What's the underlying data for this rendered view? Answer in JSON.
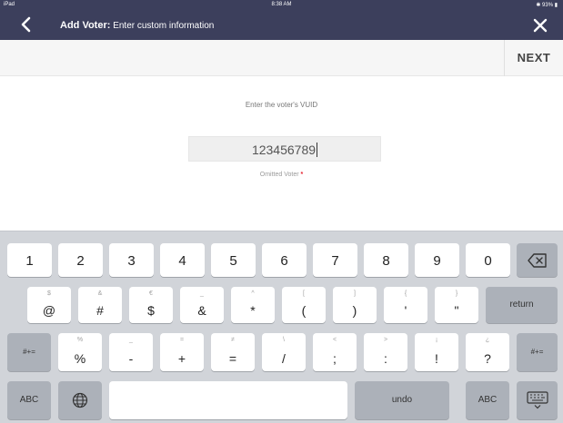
{
  "status_bar": {
    "left": "iPad",
    "time": "8:38 AM",
    "right": "✱ 93% ▮"
  },
  "header": {
    "back_icon": "chevron-left-icon",
    "title_strong": "Add Voter:",
    "title_sub": "Enter custom information",
    "close_icon": "close-icon"
  },
  "toolbar": {
    "next_label": "NEXT"
  },
  "form": {
    "prompt": "Enter the voter's VUID",
    "vuid_value": "123456789",
    "status_label": "Omitted Voter",
    "required_marker": "*"
  },
  "keyboard": {
    "row1": [
      "1",
      "2",
      "3",
      "4",
      "5",
      "6",
      "7",
      "8",
      "9",
      "0"
    ],
    "row2": [
      {
        "main": "@",
        "hint": "$"
      },
      {
        "main": "#",
        "hint": "&"
      },
      {
        "main": "$",
        "hint": "€"
      },
      {
        "main": "&",
        "hint": "_"
      },
      {
        "main": "*",
        "hint": "^"
      },
      {
        "main": "(",
        "hint": "["
      },
      {
        "main": ")",
        "hint": "]"
      },
      {
        "main": "'",
        "hint": "{"
      },
      {
        "main": "\"",
        "hint": "}"
      }
    ],
    "row3": [
      {
        "main": "%",
        "hint": "%"
      },
      {
        "main": "-",
        "hint": "_"
      },
      {
        "main": "+",
        "hint": "="
      },
      {
        "main": "=",
        "hint": "≠"
      },
      {
        "main": "/",
        "hint": "\\"
      },
      {
        "main": ";",
        "hint": "<"
      },
      {
        "main": ":",
        "hint": ">"
      },
      {
        "main": "!",
        "hint": "¡"
      },
      {
        "main": "?",
        "hint": "¿"
      }
    ],
    "return_label": "return",
    "shift_label": "#+=",
    "abc_label": "ABC",
    "undo_label": "undo",
    "delete_icon": "backspace-icon",
    "globe_icon": "globe-icon",
    "dismiss_icon": "keyboard-dismiss-icon"
  }
}
